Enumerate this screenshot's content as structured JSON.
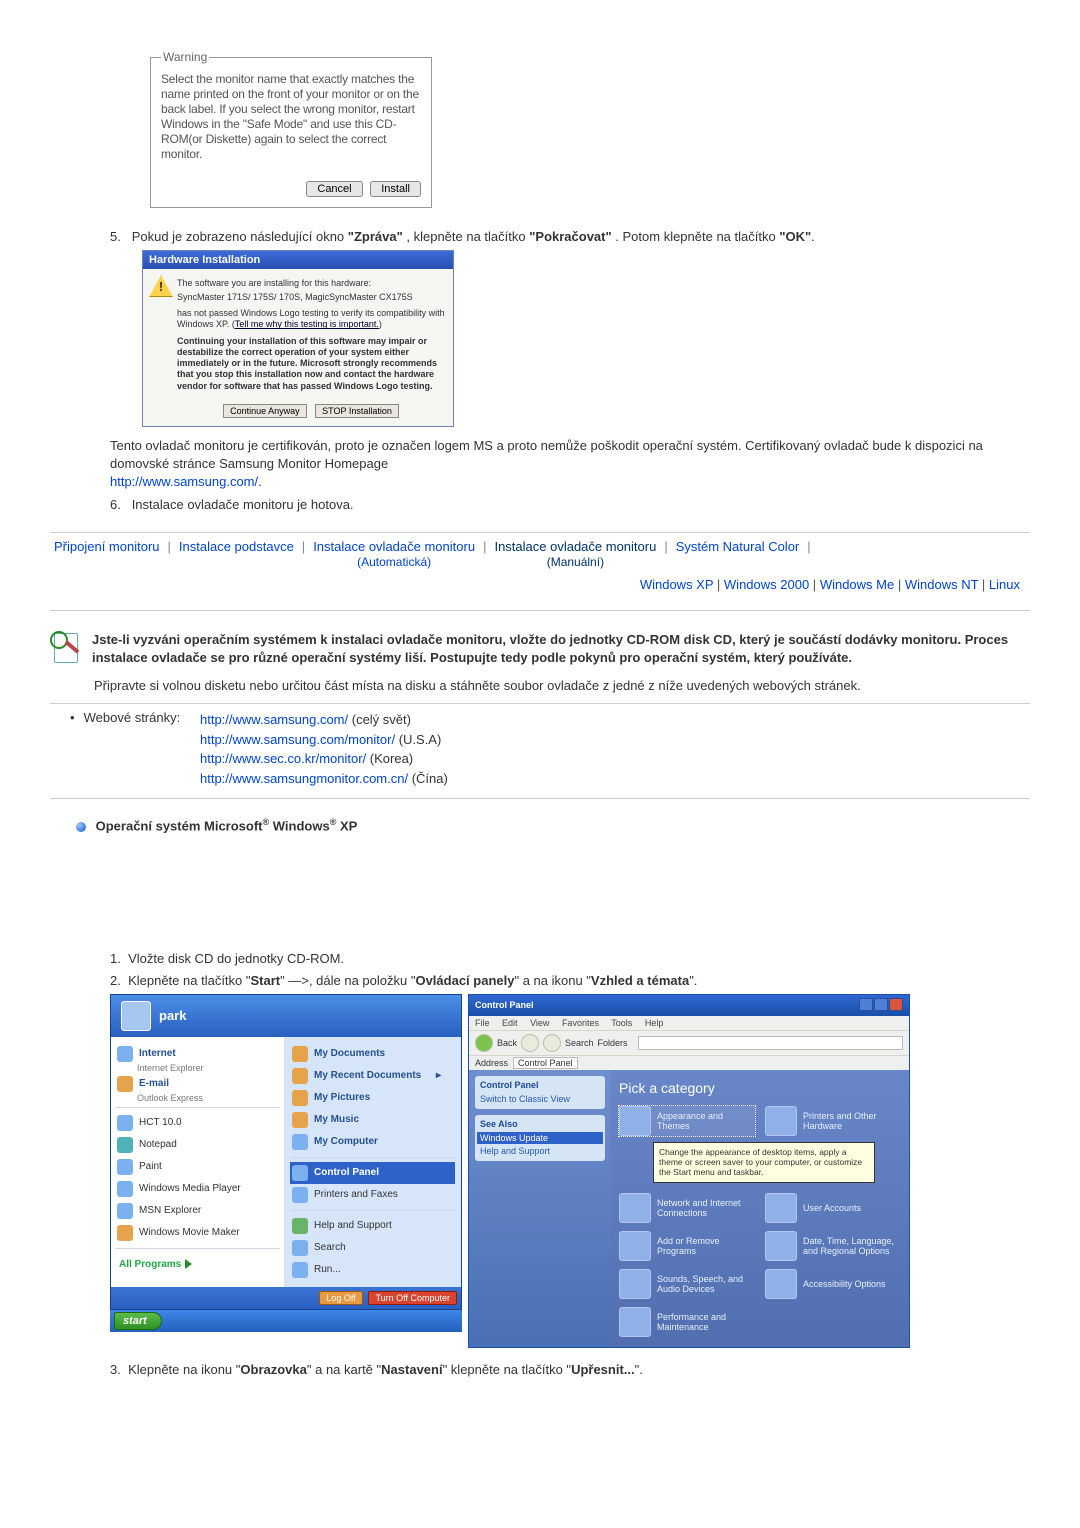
{
  "warning": {
    "legend": "Warning",
    "text": "Select the monitor name that exactly matches the name printed on the front of your monitor or on the back label. If you select the wrong monitor, restart Windows in the \"Safe Mode\" and use this CD-ROM(or Diskette) again to select the correct monitor.",
    "cancel": "Cancel",
    "install": "Install"
  },
  "step5": {
    "number": "5.",
    "text_before_bold1": "Pokud je zobrazeno následující okno ",
    "bold1": "\"Zpráva\"",
    "text_mid": ", klepněte na tlačítko ",
    "bold2": "\"Pokračovat\"",
    "text_after": ". Potom klepněte na tlačítko ",
    "bold3": "\"OK\"",
    "period": "."
  },
  "hw_dialog": {
    "title": "Hardware Installation",
    "bang": "!",
    "line1": "The software you are installing for this hardware:",
    "device": "SyncMaster 171S/ 175S/ 170S, MagicSyncMaster CX175S",
    "line2a": "has not passed Windows Logo testing to verify its compatibility with Windows XP. (",
    "line2_link": "Tell me why this testing is important.",
    "line2b": ")",
    "bold": "Continuing your installation of this software may impair or destabilize the correct operation of your system either immediately or in the future. Microsoft strongly recommends that you stop this installation now and contact the hardware vendor for software that has passed Windows Logo testing.",
    "btn_continue": "Continue Anyway",
    "btn_stop": "STOP Installation"
  },
  "after5": {
    "p": "Tento ovladač monitoru je certifikován, proto je označen logem MS a proto nemůže poškodit operační systém. Certifikovaný ovladač bude k dispozici na domovské stránce Samsung Monitor Homepage",
    "link": "http://www.samsung.com/",
    "dot": "."
  },
  "step6": {
    "number": "6.",
    "text": "Instalace ovladače monitoru je hotova."
  },
  "tabs": {
    "t1": "Připojení monitoru",
    "t2": "Instalace podstavce",
    "t3": "Instalace ovladače monitoru",
    "t3_sub": "(Automatická)",
    "t4": "Instalace ovladače monitoru",
    "t4_sub": "(Manuální)",
    "t5": "Systém Natural Color",
    "sep": "|"
  },
  "subtabs": {
    "xp": "Windows XP",
    "w2k": "Windows 2000",
    "me": "Windows Me",
    "nt": "Windows NT",
    "linux": "Linux",
    "sep": " | "
  },
  "note": {
    "bold": "Jste-li vyzváni operačním systémem k instalaci ovladače monitoru, vložte do jednotky CD-ROM disk CD, který je součástí dodávky monitoru. Proces instalace ovladače se pro různé operační systémy liší. Postupujte tedy podle pokynů pro operační systém, který používáte.",
    "p2": "Připravte si volnou disketu nebo určitou část místa na disku a stáhněte soubor ovladače z jedné z níže uvedených webových stránek."
  },
  "web": {
    "bullet": "•",
    "label": "Webové stránky:",
    "l1": "http://www.samsung.com/",
    "l1_note": " (celý svět)",
    "l2": "http://www.samsung.com/monitor/",
    "l2_note": " (U.S.A)",
    "l3": "http://www.sec.co.kr/monitor/",
    "l3_note": " (Korea)",
    "l4": "http://www.samsungmonitor.com.cn/",
    "l4_note": " (Čína)"
  },
  "os_heading": {
    "pre": "Operační systém Microsoft",
    "reg1": "®",
    "win": " Windows",
    "reg2": "®",
    "xp": " XP"
  },
  "manual_steps": {
    "s1_num": "1.",
    "s1": "Vložte disk CD do jednotky CD-ROM.",
    "s2_num": "2.",
    "s2a": "Klepněte na tlačítko \"",
    "s2_b1": "Start",
    "s2b": "\" —>, dále na položku \"",
    "s2_b2": "Ovládací panely",
    "s2c": "\" a na ikonu \"",
    "s2_b3": "Vzhled a témata",
    "s2d": "\"."
  },
  "startmenu": {
    "user": "park",
    "left": {
      "internet": "Internet",
      "internet_sub": "Internet Explorer",
      "email": "E-mail",
      "email_sub": "Outlook Express",
      "hct": "HCT 10.0",
      "notepad": "Notepad",
      "paint": "Paint",
      "wmp": "Windows Media Player",
      "msn": "MSN Explorer",
      "wmm": "Windows Movie Maker",
      "allprograms": "All Programs"
    },
    "right": {
      "mydocs": "My Documents",
      "recent": "My Recent Documents",
      "arrow": "▸",
      "pics": "My Pictures",
      "music": "My Music",
      "computer": "My Computer",
      "cpanel": "Control Panel",
      "printers": "Printers and Faxes",
      "help": "Help and Support",
      "search": "Search",
      "run": "Run..."
    },
    "footer": {
      "logoff": "Log Off",
      "turnoff": "Turn Off Computer"
    },
    "startbtn": "start"
  },
  "cpanel": {
    "title": "Control Panel",
    "menu": {
      "file": "File",
      "edit": "Edit",
      "view": "View",
      "fav": "Favorites",
      "tools": "Tools",
      "help": "Help"
    },
    "toolbar": {
      "back": "Back",
      "search": "Search",
      "folders": "Folders"
    },
    "address_label": "Address",
    "address_value": "Control Panel",
    "side": {
      "box1_title": "Control Panel",
      "box1_item": "Switch to Classic View",
      "box2_title": "See Also",
      "box2_i1": "Windows Update",
      "box2_i2": "Help and Support"
    },
    "heading": "Pick a category",
    "cats": {
      "c1": "Appearance and Themes",
      "c2": "Printers and Other Hardware",
      "callout": "Change the appearance of desktop items, apply a theme or screen saver to your computer, or customize the Start menu and taskbar.",
      "c3": "Network and Internet Connections",
      "c4": "User Accounts",
      "c5": "Add or Remove Programs",
      "c6": "Date, Time, Language, and Regional Options",
      "c7": "Sounds, Speech, and Audio Devices",
      "c8": "Accessibility Options",
      "c9": "Performance and Maintenance"
    }
  },
  "step3": {
    "num": "3.",
    "a": "Klepněte na ikonu \"",
    "b1": "Obrazovka",
    "b": "\" a na kartě \"",
    "b2": "Nastavení",
    "c": "\" klepněte na tlačítko \"",
    "b3": "Upřesnit...",
    "d": "\"."
  }
}
